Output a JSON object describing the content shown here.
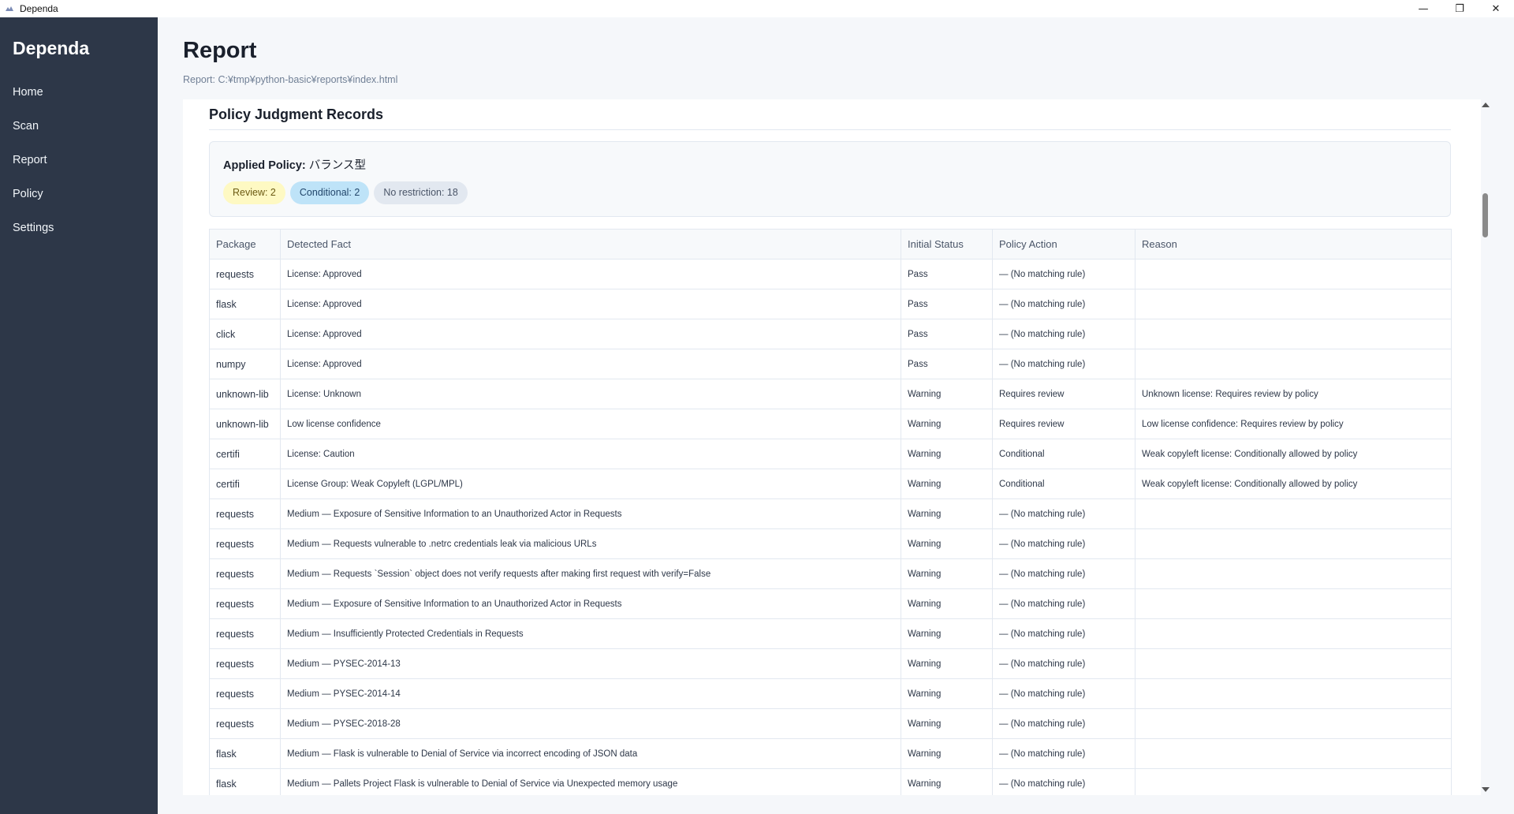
{
  "window": {
    "title": "Dependa",
    "minimize": "—",
    "maximize": "❐",
    "close": "✕"
  },
  "sidebar": {
    "brand": "Dependa",
    "items": [
      {
        "label": "Home"
      },
      {
        "label": "Scan"
      },
      {
        "label": "Report"
      },
      {
        "label": "Policy"
      },
      {
        "label": "Settings"
      }
    ]
  },
  "page": {
    "title": "Report",
    "report_path": "Report: C:¥tmp¥python-basic¥reports¥index.html"
  },
  "section": {
    "title": "Policy Judgment Records",
    "applied_policy_label": "Applied Policy:",
    "applied_policy_value": "バランス型",
    "badges": {
      "review": "Review: 2",
      "conditional": "Conditional: 2",
      "no_restriction": "No restriction: 18"
    }
  },
  "table": {
    "headers": [
      "Package",
      "Detected Fact",
      "Initial Status",
      "Policy Action",
      "Reason"
    ],
    "rows": [
      {
        "package": "requests",
        "fact": "License: Approved",
        "status": "Pass",
        "action": "— (No matching rule)",
        "reason": ""
      },
      {
        "package": "flask",
        "fact": "License: Approved",
        "status": "Pass",
        "action": "— (No matching rule)",
        "reason": ""
      },
      {
        "package": "click",
        "fact": "License: Approved",
        "status": "Pass",
        "action": "— (No matching rule)",
        "reason": ""
      },
      {
        "package": "numpy",
        "fact": "License: Approved",
        "status": "Pass",
        "action": "— (No matching rule)",
        "reason": ""
      },
      {
        "package": "unknown-lib",
        "fact": "License: Unknown",
        "status": "Warning",
        "action": "Requires review",
        "reason": "Unknown license: Requires review by policy"
      },
      {
        "package": "unknown-lib",
        "fact": "Low license confidence",
        "status": "Warning",
        "action": "Requires review",
        "reason": "Low license confidence: Requires review by policy"
      },
      {
        "package": "certifi",
        "fact": "License: Caution",
        "status": "Warning",
        "action": "Conditional",
        "reason": "Weak copyleft license: Conditionally allowed by policy"
      },
      {
        "package": "certifi",
        "fact": "License Group: Weak Copyleft (LGPL/MPL)",
        "status": "Warning",
        "action": "Conditional",
        "reason": "Weak copyleft license: Conditionally allowed by policy"
      },
      {
        "package": "requests",
        "fact": "Medium — Exposure of Sensitive Information to an Unauthorized Actor in Requests",
        "status": "Warning",
        "action": "— (No matching rule)",
        "reason": ""
      },
      {
        "package": "requests",
        "fact": "Medium — Requests vulnerable to .netrc credentials leak via malicious URLs",
        "status": "Warning",
        "action": "— (No matching rule)",
        "reason": ""
      },
      {
        "package": "requests",
        "fact": "Medium — Requests `Session` object does not verify requests after making first request with verify=False",
        "status": "Warning",
        "action": "— (No matching rule)",
        "reason": ""
      },
      {
        "package": "requests",
        "fact": "Medium — Exposure of Sensitive Information to an Unauthorized Actor in Requests",
        "status": "Warning",
        "action": "— (No matching rule)",
        "reason": ""
      },
      {
        "package": "requests",
        "fact": "Medium — Insufficiently Protected Credentials in Requests",
        "status": "Warning",
        "action": "— (No matching rule)",
        "reason": ""
      },
      {
        "package": "requests",
        "fact": "Medium — PYSEC-2014-13",
        "status": "Warning",
        "action": "— (No matching rule)",
        "reason": ""
      },
      {
        "package": "requests",
        "fact": "Medium — PYSEC-2014-14",
        "status": "Warning",
        "action": "— (No matching rule)",
        "reason": ""
      },
      {
        "package": "requests",
        "fact": "Medium — PYSEC-2018-28",
        "status": "Warning",
        "action": "— (No matching rule)",
        "reason": ""
      },
      {
        "package": "flask",
        "fact": "Medium — Flask is vulnerable to Denial of Service via incorrect encoding of JSON data",
        "status": "Warning",
        "action": "— (No matching rule)",
        "reason": ""
      },
      {
        "package": "flask",
        "fact": "Medium — Pallets Project Flask is vulnerable to Denial of Service via Unexpected memory usage",
        "status": "Warning",
        "action": "— (No matching rule)",
        "reason": ""
      }
    ]
  },
  "colors": {
    "sidebar_bg": "#2d3748",
    "pass": "#2f855a",
    "warning": "#dd6b20",
    "requires_review": "#c05621",
    "conditional": "#2b6cb0",
    "no_rule": "#718096"
  },
  "icons": {
    "app": "dependa-app-icon",
    "scroll_up": "scroll-up-arrow-icon",
    "scroll_down": "scroll-down-arrow-icon"
  }
}
